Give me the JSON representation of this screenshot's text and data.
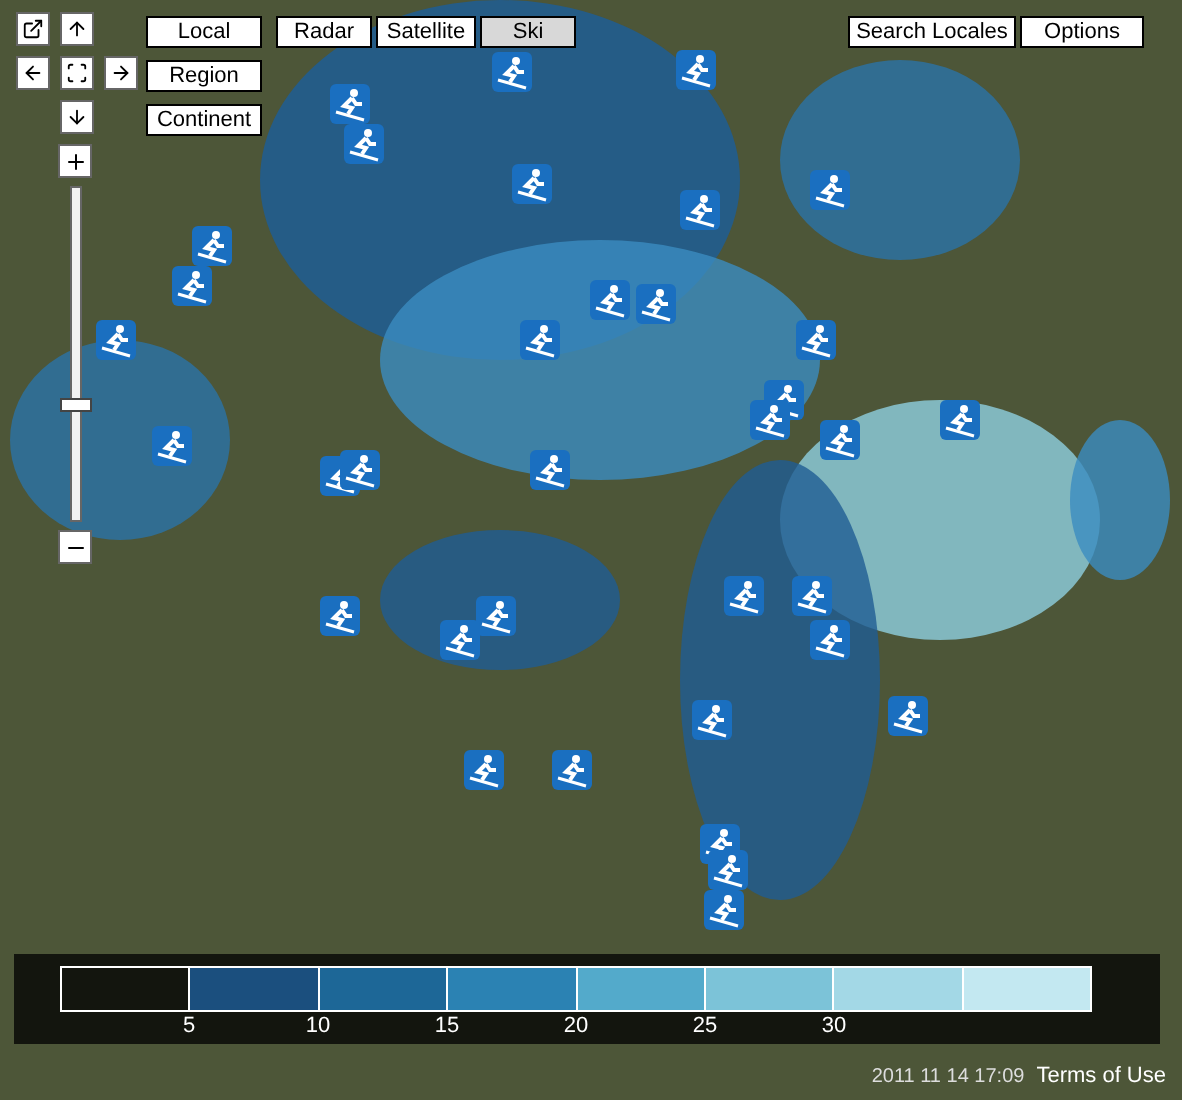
{
  "scale_buttons": [
    {
      "label": "Local",
      "selected": false
    },
    {
      "label": "Region",
      "selected": false
    },
    {
      "label": "Continent",
      "selected": false
    }
  ],
  "map_types": [
    {
      "label": "Radar",
      "selected": false
    },
    {
      "label": "Satellite",
      "selected": false
    },
    {
      "label": "Ski",
      "selected": true
    }
  ],
  "top_right_buttons": [
    {
      "label": "Search Locales"
    },
    {
      "label": "Options"
    }
  ],
  "zoom": {
    "level": 0.34
  },
  "legend": {
    "ticks": [
      "5",
      "10",
      "15",
      "20",
      "25",
      "30"
    ]
  },
  "timestamp": "2011 11 14 17:09",
  "terms_link": "Terms of Use"
}
